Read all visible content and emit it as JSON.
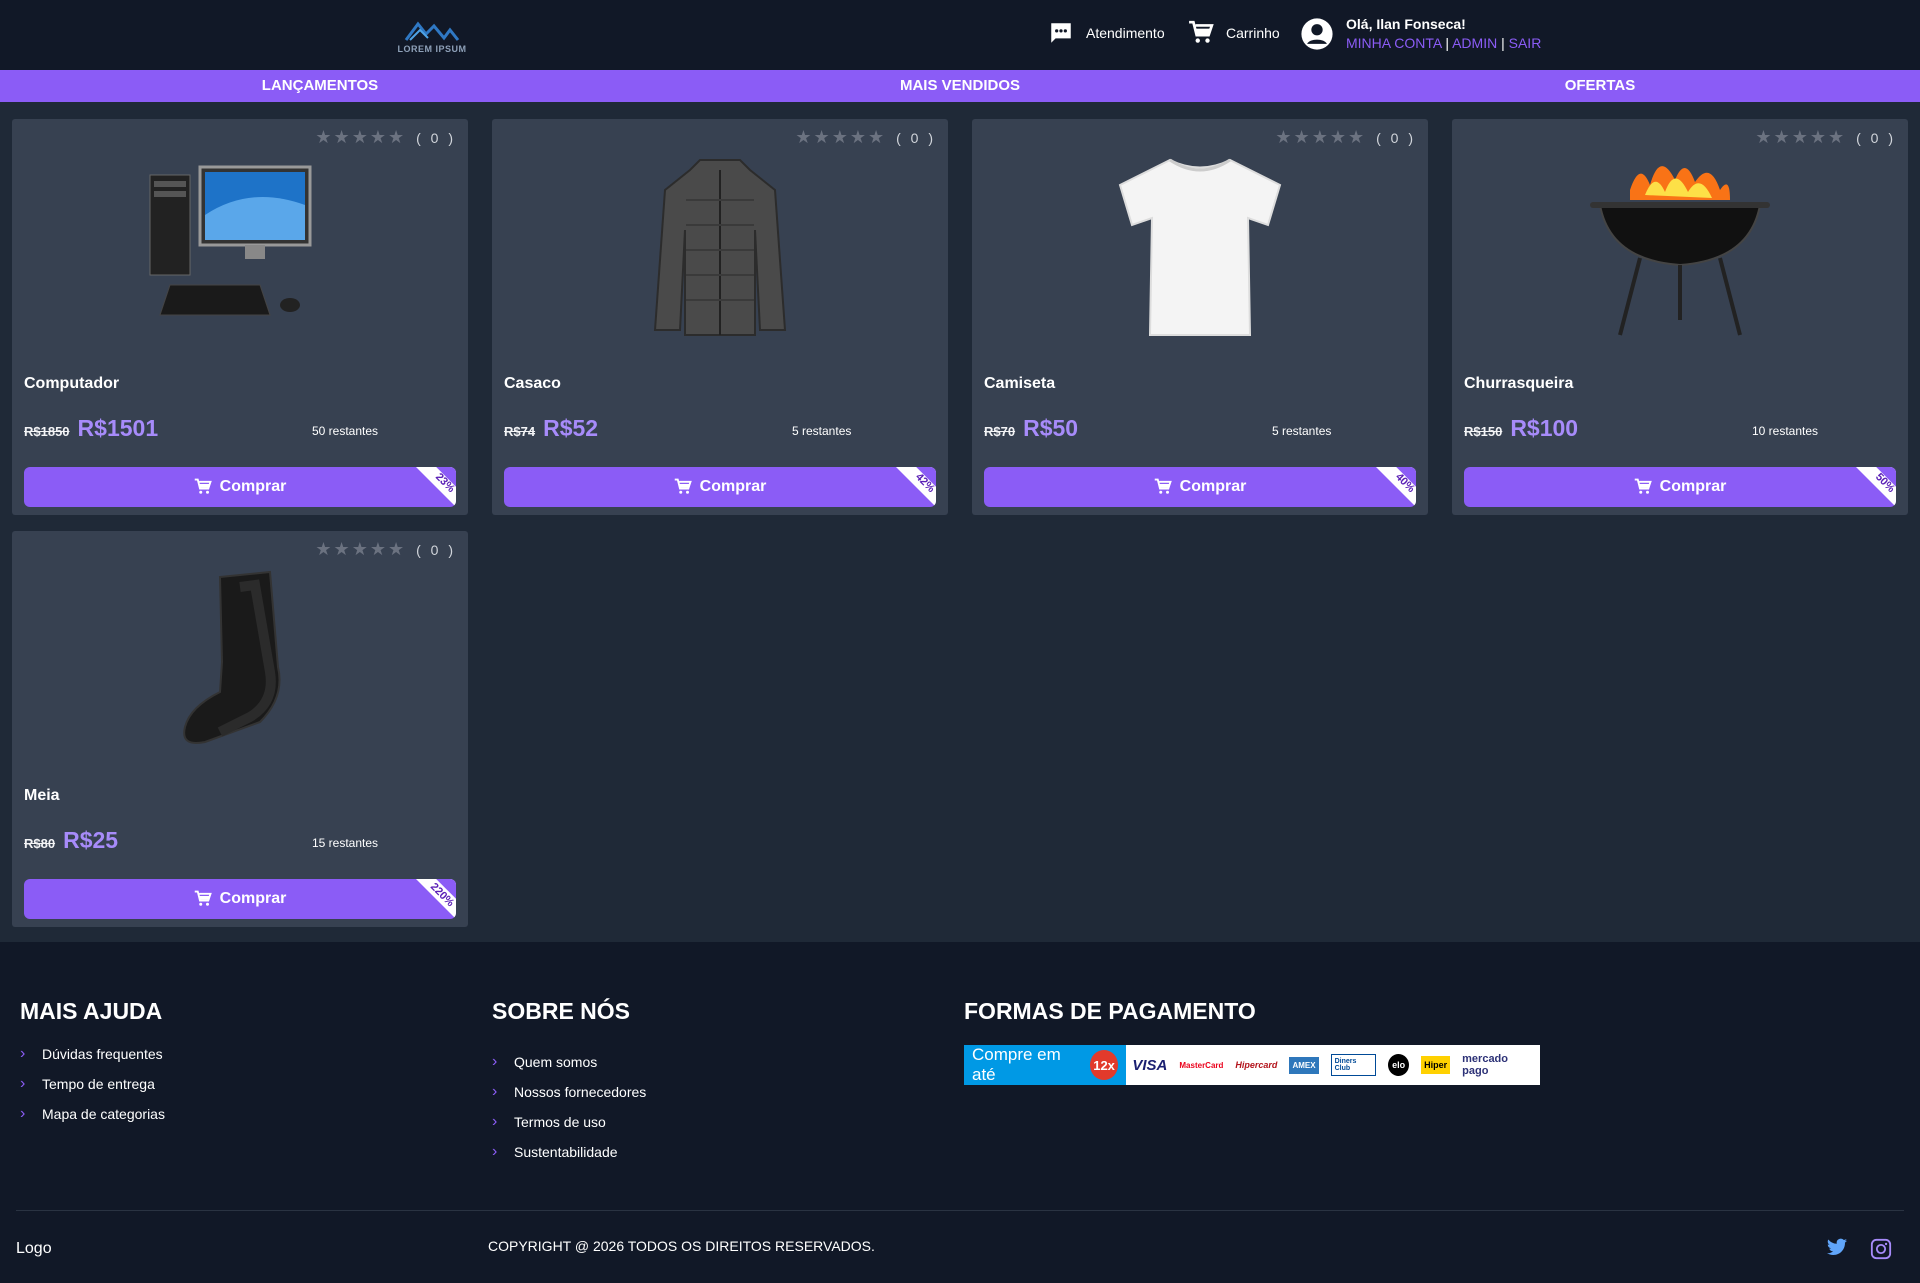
{
  "header": {
    "logo_text": "LOREM IPSUM",
    "support_label": "Atendimento",
    "cart_label": "Carrinho",
    "greeting": "Olá, Ilan Fonseca!",
    "links": {
      "account": "MINHA CONTA",
      "admin": "ADMIN",
      "logout": "SAIR",
      "sep": "|"
    }
  },
  "nav": [
    "LANÇAMENTOS",
    "MAIS VENDIDOS",
    "OFERTAS"
  ],
  "products": [
    {
      "name": "Computador",
      "old_price": "R$1850",
      "price": "R$1501",
      "stock": "50 restantes",
      "rating_count": "( 0 )",
      "discount": "23%",
      "buy_label": "Comprar",
      "image": "computer-image"
    },
    {
      "name": "Casaco",
      "old_price": "R$74",
      "price": "R$52",
      "stock": "5 restantes",
      "rating_count": "( 0 )",
      "discount": "42%",
      "buy_label": "Comprar",
      "image": "jacket-image"
    },
    {
      "name": "Camiseta",
      "old_price": "R$70",
      "price": "R$50",
      "stock": "5 restantes",
      "rating_count": "( 0 )",
      "discount": "40%",
      "buy_label": "Comprar",
      "image": "tshirt-image"
    },
    {
      "name": "Churrasqueira",
      "old_price": "R$150",
      "price": "R$100",
      "stock": "10 restantes",
      "rating_count": "( 0 )",
      "discount": "50%",
      "buy_label": "Comprar",
      "image": "grill-image"
    },
    {
      "name": "Meia",
      "old_price": "R$80",
      "price": "R$25",
      "stock": "15 restantes",
      "rating_count": "( 0 )",
      "discount": "220%",
      "buy_label": "Comprar",
      "image": "sock-image"
    }
  ],
  "footer": {
    "help": {
      "title": "MAIS AJUDA",
      "items": [
        "Dúvidas frequentes",
        "Tempo de entrega",
        "Mapa de categorias"
      ]
    },
    "about": {
      "title": "SOBRE NÓS",
      "items": [
        "Quem somos",
        "Nossos fornecedores",
        "Termos de uso",
        "Sustentabilidade"
      ]
    },
    "payment": {
      "title": "FORMAS DE PAGAMENTO",
      "banner_text": "Compre em até",
      "installments": "12x",
      "brands": [
        "VISA",
        "MasterCard",
        "Hipercard",
        "AMEX",
        "Diners Club",
        "elo",
        "Hiper",
        "mercado pago"
      ]
    },
    "logo": "Logo",
    "copyright": "COPYRIGHT @ 2026 TODOS OS DIREITOS RESERVADOS."
  },
  "colors": {
    "accent": "#8b5cf6",
    "header_bg": "#111827",
    "card_bg": "#374151",
    "page_bg": "#1f2937",
    "price": "#a78bfa"
  }
}
